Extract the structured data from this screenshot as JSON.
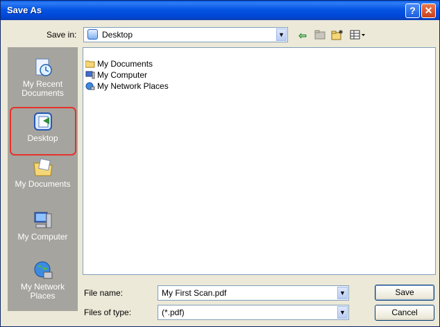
{
  "window": {
    "title": "Save As"
  },
  "titlebar": {
    "help_glyph": "?",
    "close_glyph": "✕"
  },
  "toolbar": {
    "save_in_label": "Save in:",
    "save_in_value": "Desktop",
    "back_icon": "arrow-left-icon",
    "up_icon": "folder-up-icon",
    "new_folder_icon": "new-folder-icon",
    "view_icon": "view-menu-icon"
  },
  "places": [
    {
      "label": "My Recent Documents",
      "icon": "recent-documents-icon"
    },
    {
      "label": "Desktop",
      "icon": "desktop-icon"
    },
    {
      "label": "My Documents",
      "icon": "my-documents-icon"
    },
    {
      "label": "My Computer",
      "icon": "my-computer-icon"
    },
    {
      "label": "My Network Places",
      "icon": "network-places-icon"
    }
  ],
  "files": [
    {
      "name": "My Documents",
      "icon": "folder-icon"
    },
    {
      "name": "My Computer",
      "icon": "computer-icon"
    },
    {
      "name": "My Network Places",
      "icon": "network-icon"
    }
  ],
  "form": {
    "file_name_label": "File name:",
    "file_name_value": "My First Scan.pdf",
    "file_type_label": "Files of type:",
    "file_type_value": "(*.pdf)"
  },
  "buttons": {
    "save": "Save",
    "cancel": "Cancel"
  },
  "colors": {
    "titlebar": "#0554e3",
    "dialog_bg": "#ece9d8",
    "places_bg": "#a5a49e",
    "highlight": "#e8302a"
  }
}
